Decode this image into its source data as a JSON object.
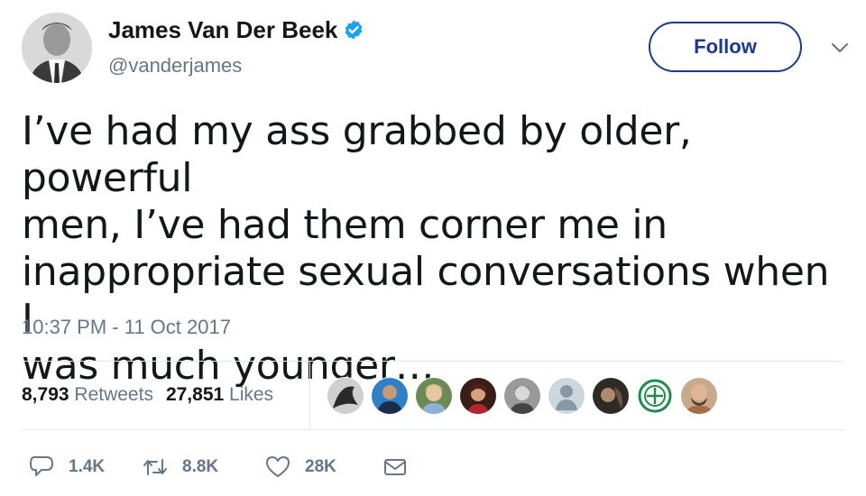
{
  "user": {
    "display_name": "James Van Der Beek",
    "handle": "@vanderjames",
    "verified": true
  },
  "follow_label": "Follow",
  "tweet": {
    "lines": [
      "I’ve had my ass grabbed by older, powerful",
      "men, I’ve had them corner me in",
      "inappropriate sexual conversations when I",
      "was much younger…"
    ],
    "timestamp": "10:37 PM - 11 Oct 2017"
  },
  "stats": {
    "retweets_count": "8,793",
    "retweets_label": "Retweets",
    "likes_count": "27,851",
    "likes_label": "Likes"
  },
  "likers_count": 9,
  "actions": {
    "reply_count": "1.4K",
    "retweet_count": "8.8K",
    "like_count": "28K"
  },
  "colors": {
    "verified": "#1da1f2",
    "follow_border": "#1b3a8c",
    "muted": "#657786",
    "text": "#14171a"
  }
}
